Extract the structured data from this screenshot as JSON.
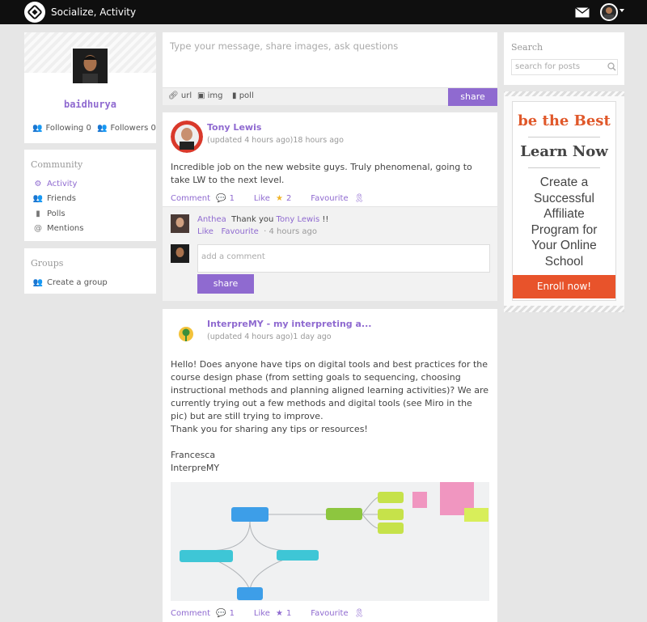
{
  "header": {
    "title": "Socialize, Activity"
  },
  "profile": {
    "name": "baidhurya",
    "following": "Following 0",
    "followers": "Followers 0"
  },
  "community": {
    "title": "Community",
    "items": [
      {
        "label": "Activity",
        "icon": "activity-icon"
      },
      {
        "label": "Friends",
        "icon": "friends-icon"
      },
      {
        "label": "Polls",
        "icon": "polls-icon"
      },
      {
        "label": "Mentions",
        "icon": "at-icon"
      }
    ]
  },
  "groups": {
    "title": "Groups",
    "create": "Create a group"
  },
  "composer": {
    "placeholder": "Type your message, share images, ask questions",
    "url": "url",
    "img": "img",
    "poll": "poll",
    "share": "share"
  },
  "post1": {
    "author": "Tony Lewis",
    "meta": "(updated 4 hours ago)18 hours ago",
    "text": "Incredible job on the new website guys. Truly phenomenal, going to take LW to the next level.",
    "comment_label": "Comment",
    "comment_count": "1",
    "like_label": "Like",
    "like_count": "2",
    "favourite_label": "Favourite",
    "reply": {
      "author": "Anthea",
      "text": "Thank you",
      "mention": "Tony Lewis",
      "suffix": "!!",
      "like": "Like",
      "favourite": "Favourite",
      "time": "· 4 hours ago"
    },
    "comment_placeholder": "add a comment",
    "share": "share"
  },
  "post2": {
    "author": "InterpreMY - my interpreting a...",
    "meta": "(updated 4 hours ago)1 day ago",
    "text": "Hello! Does anyone have tips on digital tools and best practices for the course design phase (from setting goals to sequencing, choosing instructional methods and planning aligned learning activities)? We are currently trying out a few methods and digital tools (see Miro in the pic) but are still trying to improve.",
    "thanks": "Thank you for sharing any tips or resources!",
    "sign1": "Francesca",
    "sign2": "InterpreMY",
    "comment_label": "Comment",
    "comment_count": "1",
    "like_label": "Like",
    "like_count": "1",
    "favourite_label": "Favourite"
  },
  "search": {
    "title": "Search",
    "placeholder": "search for posts"
  },
  "ad": {
    "headline": "be the Best",
    "subhead": "Learn Now",
    "body": [
      "Create a",
      "Successful",
      "Affiliate",
      "Program for",
      "Your Online",
      "School"
    ],
    "cta": "Enroll now!"
  },
  "colors": {
    "accent": "#8f6ad0",
    "cta": "#e8532b",
    "topbar": "#0f0f0f"
  }
}
